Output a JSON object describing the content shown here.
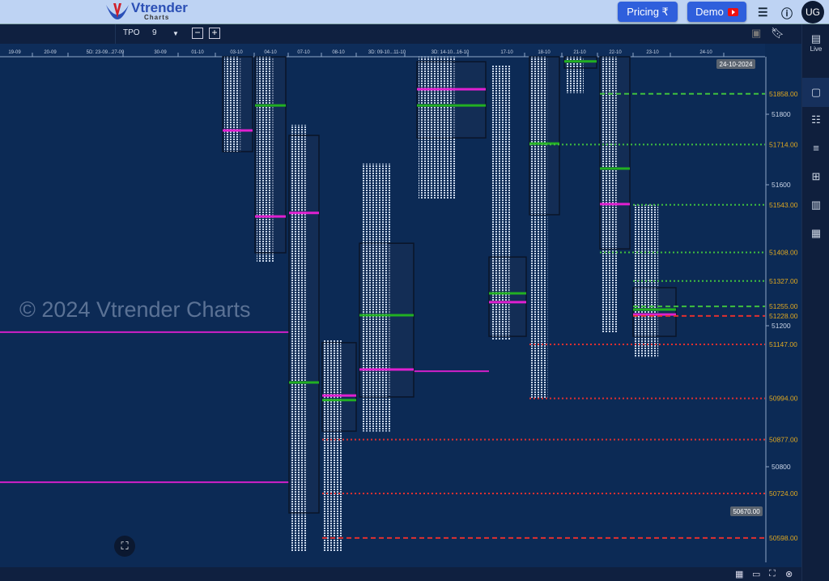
{
  "header": {
    "logo_text": "Vtrender",
    "logo_sub": "Charts",
    "pricing_label": "Pricing ₹",
    "demo_label": "Demo",
    "avatar": "UG"
  },
  "toolbar": {
    "chart_type": "TPO",
    "tpo_size": "9",
    "minus": "−",
    "plus": "+"
  },
  "sidebar": {
    "live_label": "Live"
  },
  "watermark": "© 2024 Vtrender Charts",
  "chart_data": {
    "type": "tpo-profile",
    "date_labels": [
      "19-09",
      "20-09",
      "5D: 23-09...27-09",
      "30-09",
      "01-10",
      "03-10",
      "04-10",
      "07-10",
      "08-10",
      "3D: 09-10...11-10",
      "3D: 14-10...16-10",
      "17-10",
      "18-10",
      "21-10",
      "22-10",
      "23-10",
      "24-10"
    ],
    "current_date": "24-10-2024",
    "current_price_label": "50670.00",
    "yaxis_ticks": [
      51800,
      51600,
      51200,
      50800
    ],
    "ylim": [
      50560,
      51970
    ],
    "profiles": [
      {
        "date": "03-10",
        "high": 51963,
        "low": 51694,
        "va_high": 51963,
        "va_low": 51694,
        "poc": 51754,
        "poc_color": "#e020d0"
      },
      {
        "date": "04-10",
        "high": 51963,
        "low": 51380,
        "va_high": 51963,
        "va_low": 51407,
        "poc": 51825,
        "poc_color": "#22b022",
        "poc2": 51510
      },
      {
        "date": "07-10",
        "high": 51770,
        "low": 50560,
        "va_high": 51740,
        "va_low": 50669,
        "poc": 51039,
        "poc_color": "#22b022",
        "poc2": 51520
      },
      {
        "date": "08-10",
        "high": 51160,
        "low": 50560,
        "va_high": 51152,
        "va_low": 50901,
        "poc": 50989,
        "poc_color": "#22b022",
        "poc2": 51002
      },
      {
        "date": "3D: 09-10...11-10",
        "high": 51660,
        "low": 50900,
        "va_high": 51434,
        "va_low": 50998,
        "poc": 51230,
        "poc_color": "#22b022",
        "poc2": 51076
      },
      {
        "date": "3D: 14-10...16-10",
        "high": 51963,
        "low": 51560,
        "va_high": 51949,
        "va_low": 51733,
        "poc": 51825,
        "poc_color": "#22b022",
        "poc2": 51871
      },
      {
        "date": "17-10",
        "high": 51940,
        "low": 51160,
        "va_high": 51395,
        "va_low": 51170,
        "poc": 51292,
        "poc_color": "#22b022",
        "poc2": 51267
      },
      {
        "date": "18-10",
        "high": 51963,
        "low": 50994,
        "va_high": 51963,
        "va_low": 51515,
        "poc": 51717,
        "poc_color": "#22b022"
      },
      {
        "date": "21-10",
        "high": 51963,
        "low": 51860,
        "va_high": 51963,
        "va_low": 51931,
        "poc": 51950,
        "poc_color": "#22b022"
      },
      {
        "date": "22-10",
        "high": 51963,
        "low": 51180,
        "va_high": 51963,
        "va_low": 51418,
        "poc": 51646,
        "poc_color": "#22b022",
        "poc2": 51545
      },
      {
        "date": "23-10",
        "high": 51543,
        "low": 51110,
        "va_high": 51308,
        "va_low": 51170,
        "poc": 51246,
        "poc_color": "#22b022",
        "poc2": 51232
      }
    ],
    "naked_pocs": [
      {
        "price": 51182,
        "from": "19-09",
        "to": "07-10"
      },
      {
        "price": 50756,
        "from": "19-09",
        "to": "07-10"
      },
      {
        "price": 51071,
        "from": "3D: 09-10...11-10",
        "to": "17-10"
      }
    ],
    "reference_levels": [
      {
        "price": 51858,
        "label": "51858.00",
        "style": "dashed",
        "color": "#3fbf3f",
        "from": "22-10"
      },
      {
        "price": 51714,
        "label": "51714.00",
        "style": "dotted",
        "color": "#3fbf3f",
        "from": "18-10"
      },
      {
        "price": 51543,
        "label": "51543.00",
        "style": "dotted",
        "color": "#3fbf3f",
        "from": "23-10"
      },
      {
        "price": 51408,
        "label": "51408.00",
        "style": "dotted",
        "color": "#3fbf3f",
        "from": "22-10"
      },
      {
        "price": 51327,
        "label": "51327.00",
        "style": "dotted",
        "color": "#3fbf3f",
        "from": "23-10"
      },
      {
        "price": 51255,
        "label": "51255.00",
        "style": "dashed",
        "color": "#3fbf3f",
        "from": "23-10"
      },
      {
        "price": 51228,
        "label": "51228.00",
        "style": "dashed",
        "color": "#e03030",
        "from": "23-10"
      },
      {
        "price": 51147,
        "label": "51147.00",
        "style": "dotted",
        "color": "#e03030",
        "from": "18-10"
      },
      {
        "price": 50994,
        "label": "50994.00",
        "style": "dotted",
        "color": "#e03030",
        "from": "18-10"
      },
      {
        "price": 50877,
        "label": "50877.00",
        "style": "dotted",
        "color": "#e03030",
        "from": "08-10"
      },
      {
        "price": 50724,
        "label": "50724.00",
        "style": "dotted",
        "color": "#e03030",
        "from": "08-10"
      },
      {
        "price": 50598,
        "label": "50598.00",
        "style": "dashed",
        "color": "#e03030",
        "from": "08-10"
      }
    ]
  }
}
